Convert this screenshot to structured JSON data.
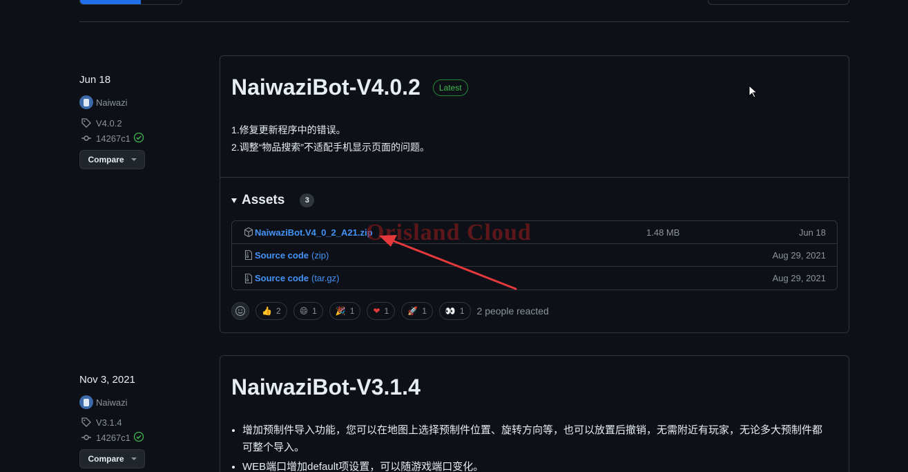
{
  "colors": {
    "bg": "#0d1117",
    "border": "#30363d",
    "link": "#4493f8",
    "muted": "#8b949e",
    "latest": "#3fb950",
    "annotation": "#e5393b"
  },
  "watermark": "Orisland Cloud",
  "releases": [
    {
      "date": "Jun 18",
      "author": "Naiwazi",
      "tag": "V4.0.2",
      "commit": "14267c1",
      "compare_label": "Compare",
      "title": "NaiwaziBot-V4.0.2",
      "badge": "Latest",
      "notes": [
        "1.修复更新程序中的错误。",
        "2.调整“物品搜索”不适配手机显示页面的问题。"
      ],
      "assets_label": "Assets",
      "assets_count": "3",
      "assets": [
        {
          "icon": "package-icon",
          "name": "NaiwaziBot.V4_0_2_A21.zip",
          "suffix": "",
          "size": "1.48 MB",
          "date": "Jun 18"
        },
        {
          "icon": "file-zip-icon",
          "name": "Source code",
          "suffix": "(zip)",
          "size": "",
          "date": "Aug 29, 2021"
        },
        {
          "icon": "file-zip-icon",
          "name": "Source code",
          "suffix": "(tar.gz)",
          "size": "",
          "date": "Aug 29, 2021"
        }
      ],
      "reactions": [
        {
          "icon": "thumbs-up-emoji",
          "emoji": "👍",
          "count": "2"
        },
        {
          "icon": "laugh-emoji",
          "emoji": "😄",
          "count": "1"
        },
        {
          "icon": "hooray-emoji",
          "emoji": "🎉",
          "count": "1"
        },
        {
          "icon": "heart-emoji",
          "emoji": "❤",
          "count": "1"
        },
        {
          "icon": "rocket-emoji",
          "emoji": "🚀",
          "count": "1"
        },
        {
          "icon": "eyes-emoji",
          "emoji": "👀",
          "count": "1"
        }
      ],
      "reacted_text": "2 people reacted"
    },
    {
      "date": "Nov 3, 2021",
      "author": "Naiwazi",
      "tag": "V3.1.4",
      "commit": "14267c1",
      "compare_label": "Compare",
      "title": "NaiwaziBot-V3.1.4",
      "bullets": [
        "增加预制件导入功能，您可以在地图上选择预制件位置、旋转方向等，也可以放置后撤销，无需附近有玩家，无论多大预制件都可整个导入。",
        "WEB端口增加default项设置，可以随游戏端口变化。"
      ]
    }
  ]
}
